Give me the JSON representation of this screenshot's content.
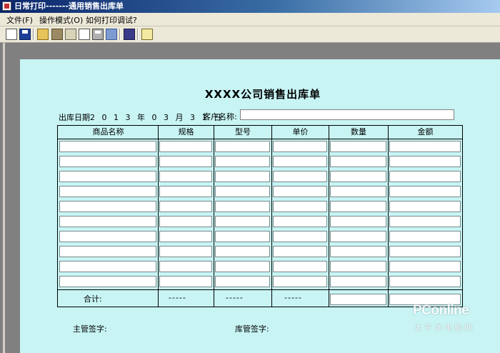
{
  "window": {
    "title": "日常打印-------通用销售出库单"
  },
  "menu": {
    "items": [
      "文件(F)",
      "操作模式(O)",
      "如何打印调试?"
    ]
  },
  "toolbar": {
    "buttons": [
      "new-icon",
      "save-icon",
      "open-icon",
      "settings-icon",
      "image-icon",
      "print-preview-icon",
      "print-icon",
      "page-setup-icon",
      "calculator-icon",
      "help-icon"
    ]
  },
  "form": {
    "title": "XXXX公司销售出库单",
    "date_label": "出库日期",
    "date_value": "2 0 1 3 年 0 3 月 3 1 日",
    "customer_label": "客户名称:",
    "customer_value": ""
  },
  "table": {
    "columns": [
      "商品名称",
      "规格",
      "型号",
      "单价",
      "数量",
      "金额"
    ],
    "row_count": 10,
    "total_label": "合计:",
    "total_placeholders": [
      "-----",
      "-----",
      "-----"
    ]
  },
  "footer": {
    "supervisor_label": "主管签字:",
    "warehouse_label": "库管签字:"
  },
  "watermark": {
    "brand": "PConline",
    "tagline": "太平洋电脑网"
  }
}
